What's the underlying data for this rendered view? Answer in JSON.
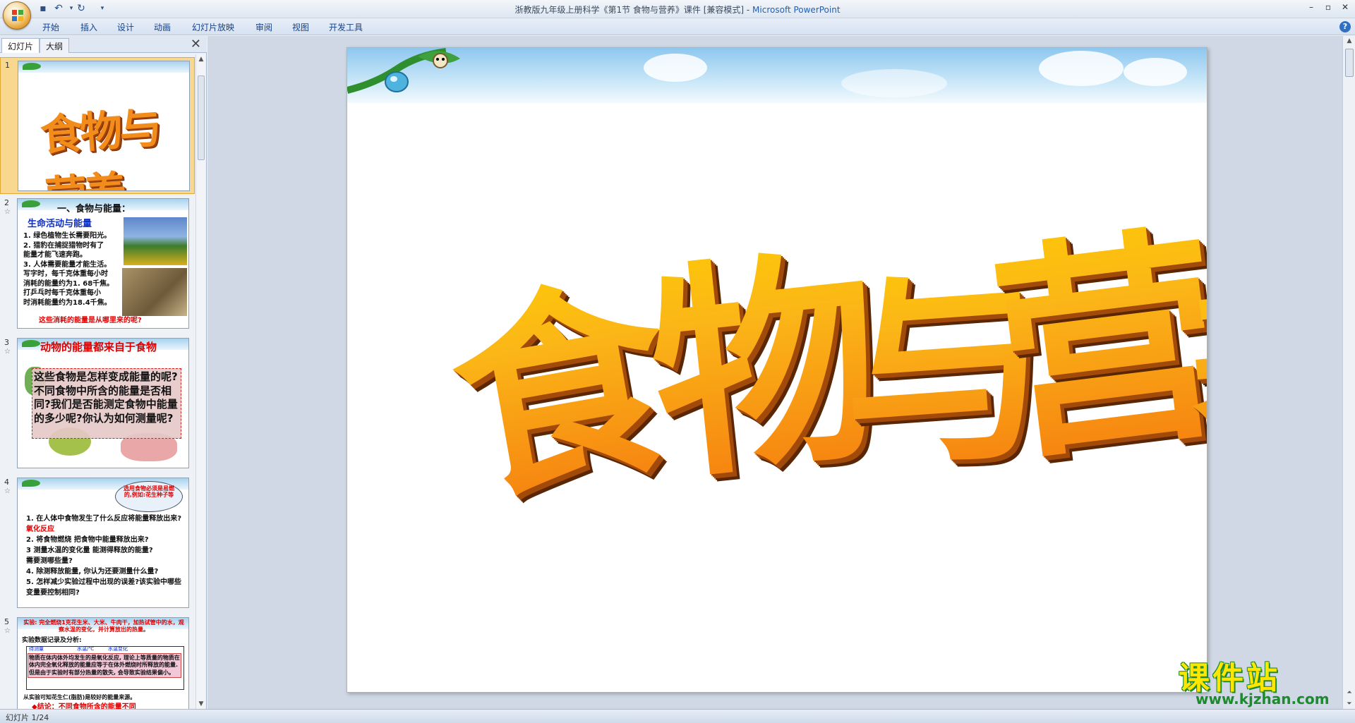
{
  "window": {
    "title": "浙教版九年级上册科学《第1节 食物与营养》课件 [兼容模式] - ",
    "app": "Microsoft PowerPoint"
  },
  "ribbon": {
    "tabs": [
      "开始",
      "插入",
      "设计",
      "动画",
      "幻灯片放映",
      "审阅",
      "视图",
      "开发工具"
    ]
  },
  "pane": {
    "tabs": [
      "幻灯片",
      "大纲"
    ]
  },
  "slides": [
    {
      "num": "1",
      "title": "食物与营养"
    },
    {
      "num": "2",
      "heading": "一、食物与能量：",
      "subheading": "生命活动与能量",
      "lines": [
        "1. 绿色植物生长需要阳光。",
        "2. 猎豹在捕捉猎物时有了",
        "能量才能飞速奔跑。",
        "3. 人体需要能量才能生活。",
        "写字时，每千克体重每小时",
        "消耗的能量约为1. 68千焦。",
        "打乒乓时每千克体重每小",
        "时消耗能量约为18.4千焦。"
      ],
      "footer": "这些消耗的能量是从哪里来的呢?"
    },
    {
      "num": "3",
      "heading": "动物的能量都来自于食物",
      "text": "这些食物是怎样变成能量的呢?不同食物中所含的能量是否相同?我们是否能测定食物中能量的多少呢?你认为如何测量呢?"
    },
    {
      "num": "4",
      "bubble": "选用食物必须是易燃的,例如:花生种子等",
      "lines": [
        "1. 在人体中食物发生了什么反应将能量释放出来?",
        "氧化反应",
        "2. 将食物燃烧 把食物中能量释放出来?",
        "3 测量水温的变化量 能测得释放的能量?",
        "需要测哪些量?",
        "4. 除测释放能量, 你认为还要测量什么量?",
        "5. 怎样减少实验过程中出现的误差?该实验中哪些变量要控制相同?"
      ]
    },
    {
      "num": "5",
      "top": "实验: 完全燃烧1克花生米、大米、牛肉干，加热试管中的水，观察水温的变化，并计算放出的热量。",
      "label": "实验数据记录及分析:",
      "col": [
        "待测量",
        "水温/℃",
        "水温变化"
      ],
      "box": "物质在体内体外均发生的是氧化反应, 理论上等质量的物质在体内完全氧化释放的能量应等于在体外燃烧时所释放的能量. 但是由于实验时有部分热量的散失, 会导致实验结果偏小。",
      "foot": "从实验可知花生仁(脂肪)是较好的能量来源。",
      "conclusion": "◆结论：不同食物所含的能量不同"
    }
  ],
  "main_slide": {
    "title": "食物与营养"
  },
  "status": {
    "slide_count": "幻灯片 1/24"
  },
  "watermark": {
    "title": "课件站",
    "url": "www.kjzhan.com"
  }
}
